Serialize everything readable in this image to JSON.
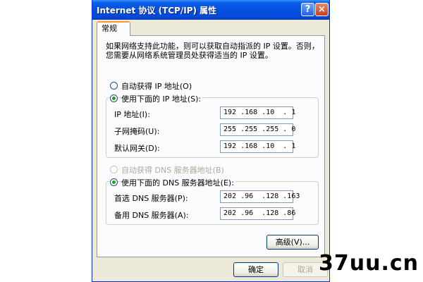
{
  "window": {
    "title": "Internet 协议 (TCP/IP) 属性",
    "help_label": "?",
    "close_label": "×"
  },
  "tab": {
    "label": "常规"
  },
  "description": {
    "line1": "如果网络支持此功能，则可以获取自动指派的 IP 设置。否则，",
    "line2": "您需要从网络系统管理员处获得适当的 IP 设置。"
  },
  "ip_section": {
    "auto_label": "自动获得 IP 地址(O)",
    "manual_label": "使用下面的 IP 地址(S):",
    "selected": "manual",
    "fields": [
      {
        "label": "IP 地址(I):",
        "value": "192 .168 .10  . 1"
      },
      {
        "label": "子网掩码(U):",
        "value": "255 .255 .255 . 0"
      },
      {
        "label": "默认网关(D):",
        "value": "192 .168 .10  . 1"
      }
    ]
  },
  "dns_section": {
    "auto_label": "自动获得 DNS 服务器地址(B)",
    "manual_label": "使用下面的 DNS 服务器地址(E):",
    "selected": "manual",
    "fields": [
      {
        "label": "首选 DNS 服务器(P):",
        "value": "202 .96  .128 .163"
      },
      {
        "label": "备用 DNS 服务器(A):",
        "value": "202 .96  .128 .86"
      }
    ]
  },
  "buttons": {
    "advanced": "高级(V)...",
    "ok": "确定",
    "cancel": "取消"
  },
  "watermark": {
    "text": "37uu.cn"
  }
}
